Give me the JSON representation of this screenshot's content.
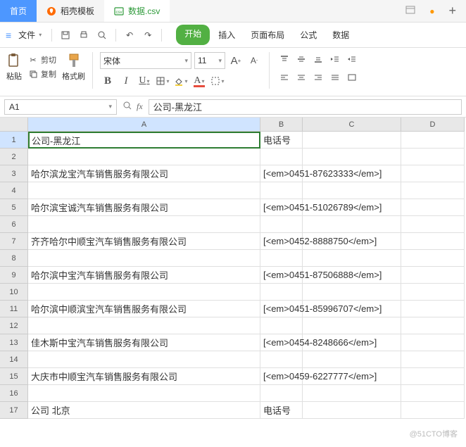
{
  "tabs": {
    "home": "首页",
    "template": "稻壳模板",
    "file": "数据.csv"
  },
  "menubar": {
    "file": "文件",
    "start": "开始",
    "insert": "插入",
    "page_layout": "页面布局",
    "formula": "公式",
    "data": "数据"
  },
  "clipboard": {
    "paste": "粘贴",
    "cut": "剪切",
    "copy": "复制",
    "format_painter": "格式刷"
  },
  "font": {
    "name": "宋体",
    "size": "11"
  },
  "namebox": {
    "cell_ref": "A1",
    "formula": "公司-黑龙江"
  },
  "columns": [
    "A",
    "B",
    "C",
    "D"
  ],
  "rows": [
    {
      "n": 1,
      "a": "公司-黑龙江",
      "b": "电话号"
    },
    {
      "n": 2,
      "a": "",
      "b": ""
    },
    {
      "n": 3,
      "a": "哈尔滨龙宝汽车销售服务有限公司",
      "b": "[<em>0451-87623333</em>]"
    },
    {
      "n": 4,
      "a": "",
      "b": ""
    },
    {
      "n": 5,
      "a": "哈尔滨宝诚汽车销售服务有限公司",
      "b": "[<em>0451-51026789</em>]"
    },
    {
      "n": 6,
      "a": "",
      "b": ""
    },
    {
      "n": 7,
      "a": "齐齐哈尔中顺宝汽车销售服务有限公司",
      "b": "[<em>0452-8888750</em>]"
    },
    {
      "n": 8,
      "a": "",
      "b": ""
    },
    {
      "n": 9,
      "a": "哈尔滨中宝汽车销售服务有限公司",
      "b": "[<em>0451-87506888</em>]"
    },
    {
      "n": 10,
      "a": "",
      "b": ""
    },
    {
      "n": 11,
      "a": "哈尔滨中顺滨宝汽车销售服务有限公司",
      "b": "[<em>0451-85996707</em>]"
    },
    {
      "n": 12,
      "a": "",
      "b": ""
    },
    {
      "n": 13,
      "a": "佳木斯中宝汽车销售服务有限公司",
      "b": "[<em>0454-8248666</em>]"
    },
    {
      "n": 14,
      "a": "",
      "b": ""
    },
    {
      "n": 15,
      "a": "大庆市中顺宝汽车销售服务有限公司",
      "b": "[<em>0459-6227777</em>]"
    },
    {
      "n": 16,
      "a": "",
      "b": ""
    },
    {
      "n": 17,
      "a": "公司 北京",
      "b": "电话号"
    }
  ],
  "watermark": "@51CTO博客"
}
